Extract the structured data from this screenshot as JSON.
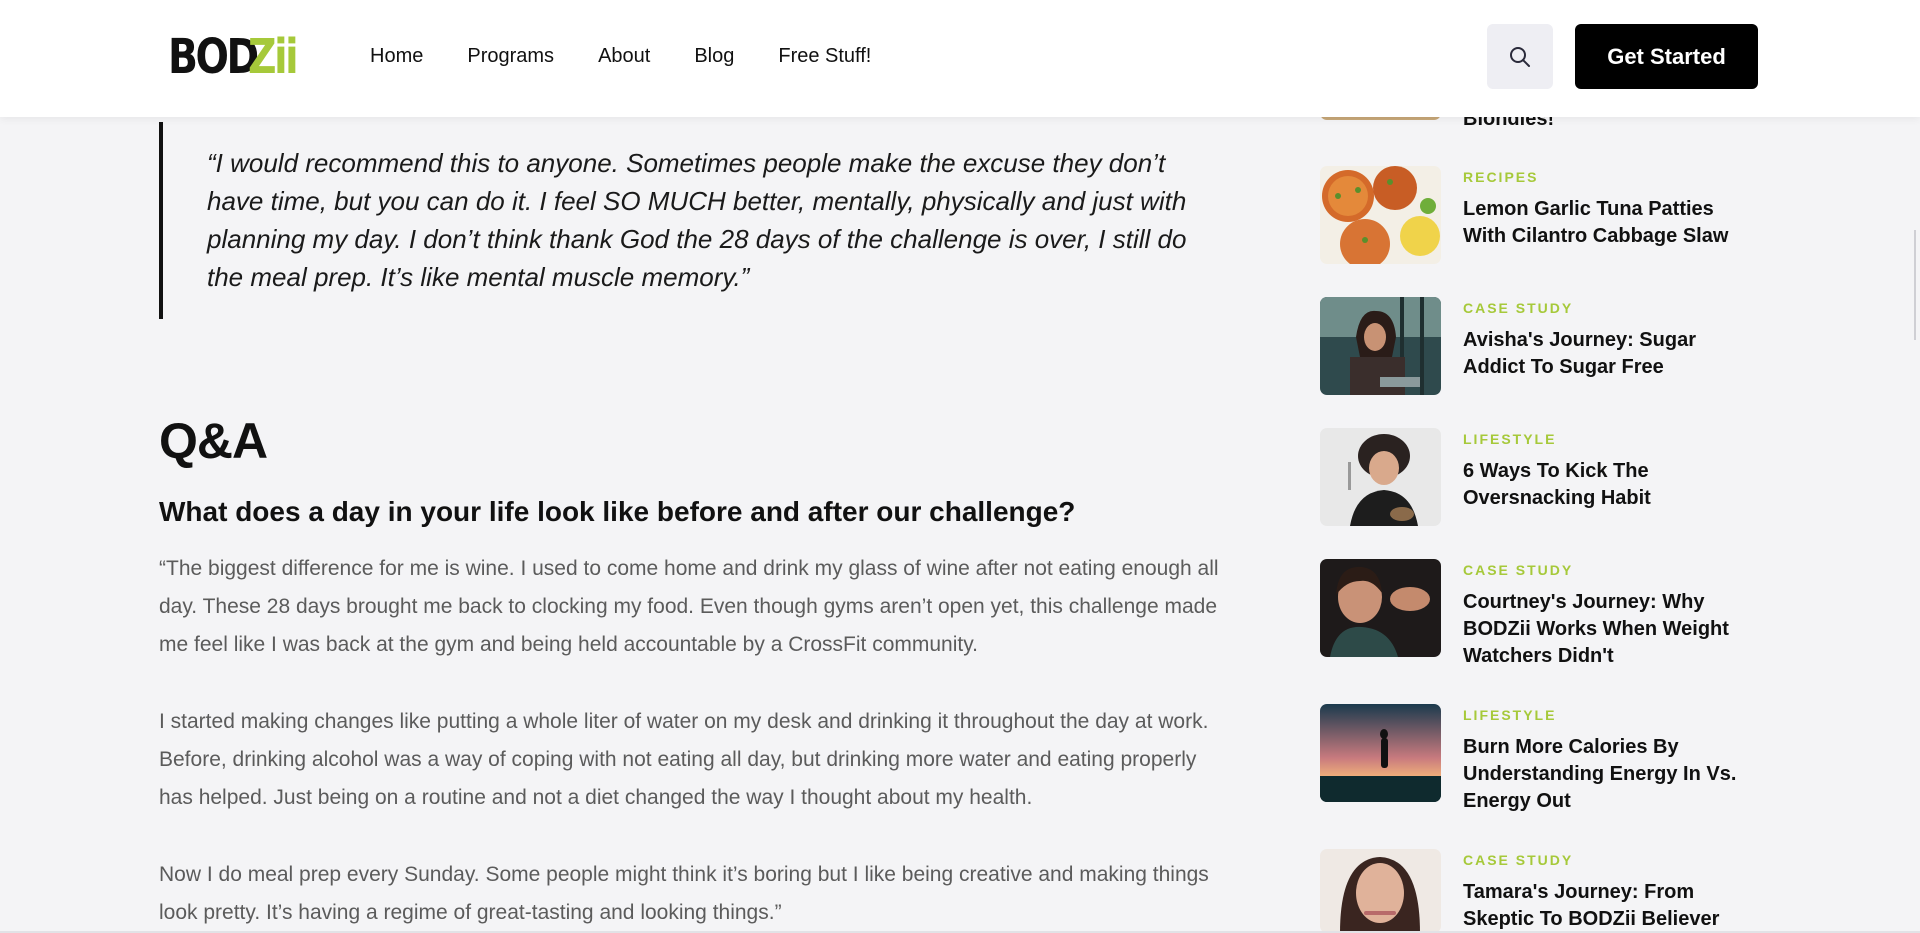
{
  "header": {
    "logo_text": "BODZii",
    "nav": [
      "Home",
      "Programs",
      "About",
      "Blog",
      "Free Stuff!"
    ],
    "search_icon": "search-icon",
    "cta_label": "Get Started"
  },
  "main": {
    "quote": "“I would recommend this to anyone. Sometimes people make the excuse they don’t have time, but you can do it. I feel SO MUCH better, mentally, physically and just with planning my day. I don’t think thank God the 28 days of the challenge is over, I still do the meal prep. It’s like mental muscle memory.”",
    "qa_heading": "Q&A",
    "question": "What does a day in your life look like before and after our challenge?",
    "paragraphs": [
      "“The biggest difference for me is wine. I used to come home and drink my glass of wine after not eating enough all day. These 28 days brought me back to clocking my food. Even though gyms aren’t open yet, this challenge made me feel like I was back at the gym and being held accountable by a CrossFit community.",
      "I started making changes like putting a whole liter of water on my desk and drinking it throughout the day at work. Before, drinking alcohol was a way of coping with not eating all day, but drinking more water and eating properly has helped. Just being on a routine and not a diet changed the way I thought about my health.",
      "Now I do meal prep every Sunday. Some people might think it’s boring but I like being creative and making things look pretty. It’s having a regime of great-tasting and looking things.”"
    ]
  },
  "sidebar": {
    "partial_title": "Blondies!",
    "items": [
      {
        "category": "RECIPES",
        "title": "Lemon Garlic Tuna Patties With Cilantro Cabbage Slaw"
      },
      {
        "category": "CASE STUDY",
        "title": "Avisha's Journey: Sugar Addict To Sugar Free"
      },
      {
        "category": "LIFESTYLE",
        "title": "6 Ways To Kick The Oversnacking Habit"
      },
      {
        "category": "CASE STUDY",
        "title": "Courtney's Journey: Why BODZii Works When Weight Watchers Didn't"
      },
      {
        "category": "LIFESTYLE",
        "title": "Burn More Calories By Understanding Energy In Vs. Energy Out"
      },
      {
        "category": "CASE STUDY",
        "title": "Tamara's Journey: From Skeptic To BODZii Believer"
      }
    ]
  },
  "colors": {
    "accent": "#a6c93a",
    "text": "#111111",
    "body_text": "#5b5b5b",
    "background": "#f4f4f6"
  }
}
